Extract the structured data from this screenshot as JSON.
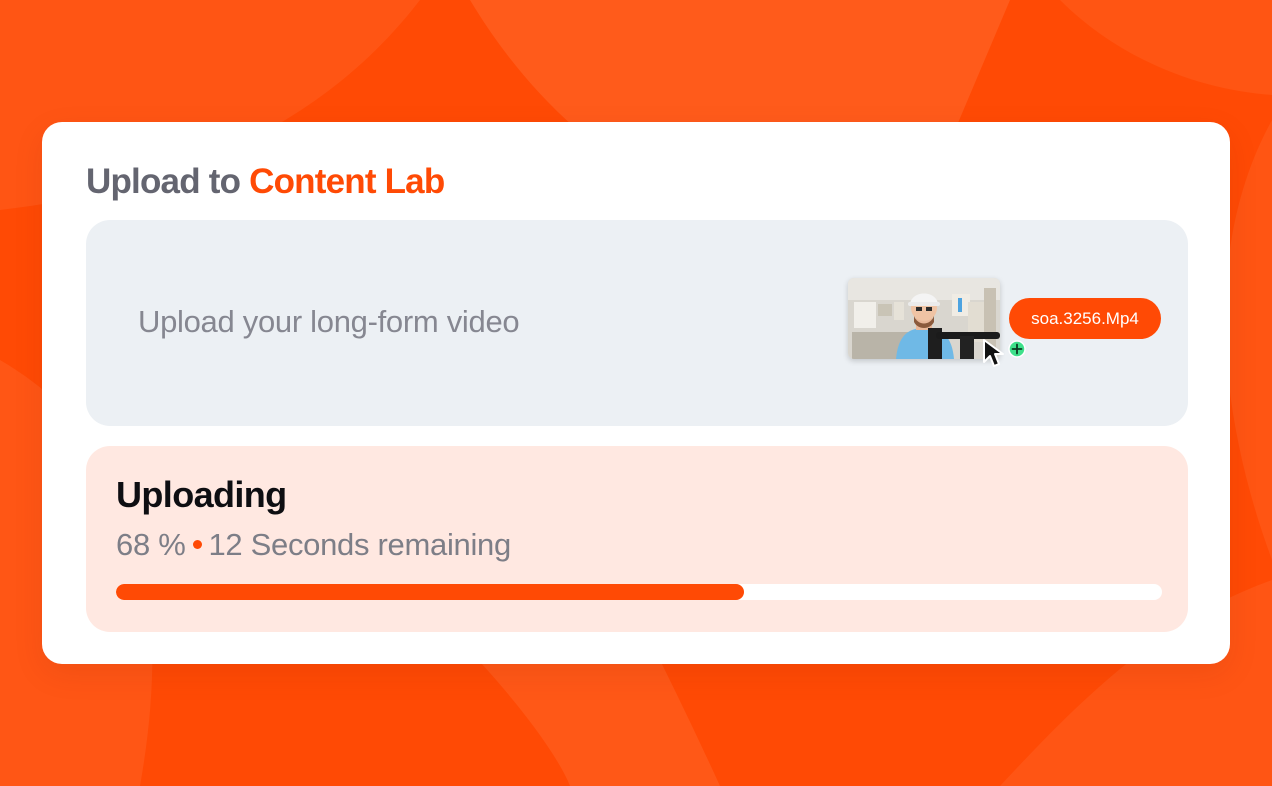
{
  "theme": {
    "accent": "#ff4a05",
    "background": "#ff4a05",
    "dropzone_bg": "#ecf0f4",
    "progress_bg": "#ffe8e1",
    "add_badge": "#3ee08a"
  },
  "card": {
    "title_prefix": "Upload to ",
    "title_brand": "Content Lab"
  },
  "dropzone": {
    "prompt": "Upload your long-form video",
    "file_name": "soa.3256.Mp4",
    "thumbnail_icon": "video-thumbnail",
    "cursor_icon": "arrow-cursor-icon",
    "add_icon": "plus-badge-icon"
  },
  "upload": {
    "title": "Uploading",
    "percent_text": "68 %",
    "remaining_text": "12 Seconds remaining",
    "progress": 0.6
  }
}
